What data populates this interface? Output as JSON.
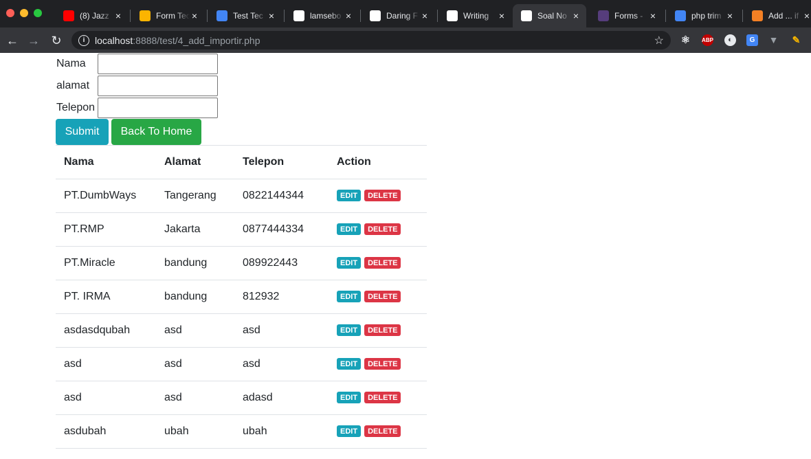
{
  "browser": {
    "tabs": [
      {
        "title": "(8) Jazz",
        "icon": "youtube-icon",
        "color": "#ff0000"
      },
      {
        "title": "Form Tec",
        "icon": "airtable-icon",
        "color": "#fcb400"
      },
      {
        "title": "Test Tec",
        "icon": "google-docs-icon",
        "color": "#4285f4"
      },
      {
        "title": "lamsebo",
        "icon": "github-icon",
        "color": "#ffffff"
      },
      {
        "title": "Daring F",
        "icon": "star-icon",
        "color": "#ffffff"
      },
      {
        "title": "Writing",
        "icon": "github-icon",
        "color": "#ffffff"
      },
      {
        "title": "Soal No",
        "icon": "skull-icon",
        "color": "#ffffff"
      },
      {
        "title": "Forms -",
        "icon": "bootstrap-icon",
        "color": "#563d7c"
      },
      {
        "title": "php trim",
        "icon": "google-icon",
        "color": "#4285f4"
      },
      {
        "title": "Add ... if",
        "icon": "stackoverflow-icon",
        "color": "#f48024"
      }
    ],
    "active_tab": 6,
    "url_host": "localhost",
    "url_path": ":8888/test/4_add_importir.php",
    "extensions": [
      "react-devtools-icon",
      "adblock-icon",
      "dark-reader-icon",
      "google-translate-icon",
      "vue-devtools-icon",
      "color-picker-icon"
    ]
  },
  "form": {
    "nama_label": "Nama",
    "alamat_label": "alamat",
    "telepon_label": "Telepon",
    "nama_value": "",
    "alamat_value": "",
    "telepon_value": "",
    "submit_label": "Submit",
    "back_label": "Back To Home"
  },
  "table": {
    "headers": [
      "Nama",
      "Alamat",
      "Telepon",
      "Action"
    ],
    "edit_label": "EDIT",
    "delete_label": "DELETE",
    "rows": [
      {
        "nama": "PT.DumbWays",
        "alamat": "Tangerang",
        "telepon": "0822144344"
      },
      {
        "nama": "PT.RMP",
        "alamat": "Jakarta",
        "telepon": "0877444334"
      },
      {
        "nama": "PT.Miracle",
        "alamat": "bandung",
        "telepon": "089922443"
      },
      {
        "nama": "PT. IRMA",
        "alamat": "bandung",
        "telepon": "812932"
      },
      {
        "nama": "asdasdqubah",
        "alamat": "asd",
        "telepon": "asd"
      },
      {
        "nama": "asd",
        "alamat": "asd",
        "telepon": "asd"
      },
      {
        "nama": "asd",
        "alamat": "asd",
        "telepon": "adasd"
      },
      {
        "nama": "asdubah",
        "alamat": "ubah",
        "telepon": "ubah"
      }
    ]
  },
  "colors": {
    "info": "#17a2b8",
    "success": "#28a745",
    "danger": "#dc3545"
  }
}
